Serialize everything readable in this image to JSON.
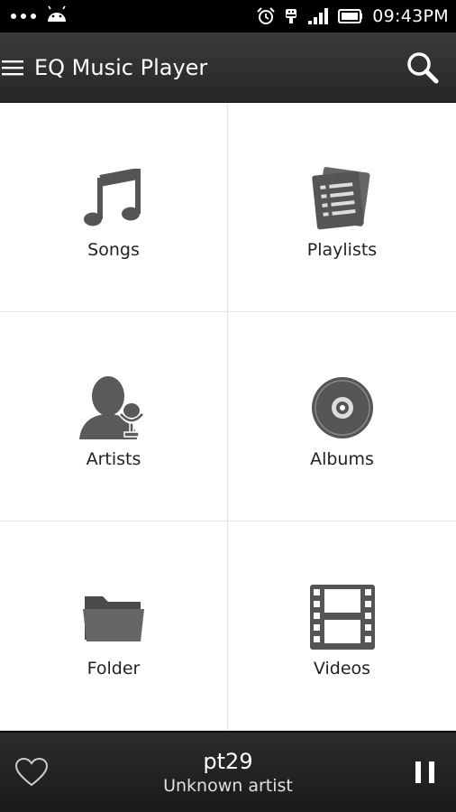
{
  "status_bar": {
    "time": "09:43PM",
    "icons": [
      "overflow-dots-icon",
      "android-icon",
      "alarm-icon",
      "usb-icon",
      "signal-icon",
      "battery-icon"
    ]
  },
  "app_bar": {
    "title": "EQ Music Player",
    "menu_icon": "hamburger-menu-icon",
    "search_icon": "search-icon"
  },
  "grid": {
    "tiles": [
      {
        "label": "Songs",
        "icon": "music-note-icon"
      },
      {
        "label": "Playlists",
        "icon": "playlist-icon"
      },
      {
        "label": "Artists",
        "icon": "artist-microphone-icon"
      },
      {
        "label": "Albums",
        "icon": "album-disc-icon"
      },
      {
        "label": "Folder",
        "icon": "folder-icon"
      },
      {
        "label": "Videos",
        "icon": "film-strip-icon"
      }
    ]
  },
  "now_playing": {
    "title": "pt29",
    "artist": "Unknown artist",
    "favorite_icon": "heart-icon",
    "control_icon": "pause-icon"
  },
  "colors": {
    "status_bar_bg": "#000000",
    "app_bar_bg": "#2f2f2f",
    "icon_gray": "#5a5a5a",
    "divider": "#e4e4e4"
  }
}
